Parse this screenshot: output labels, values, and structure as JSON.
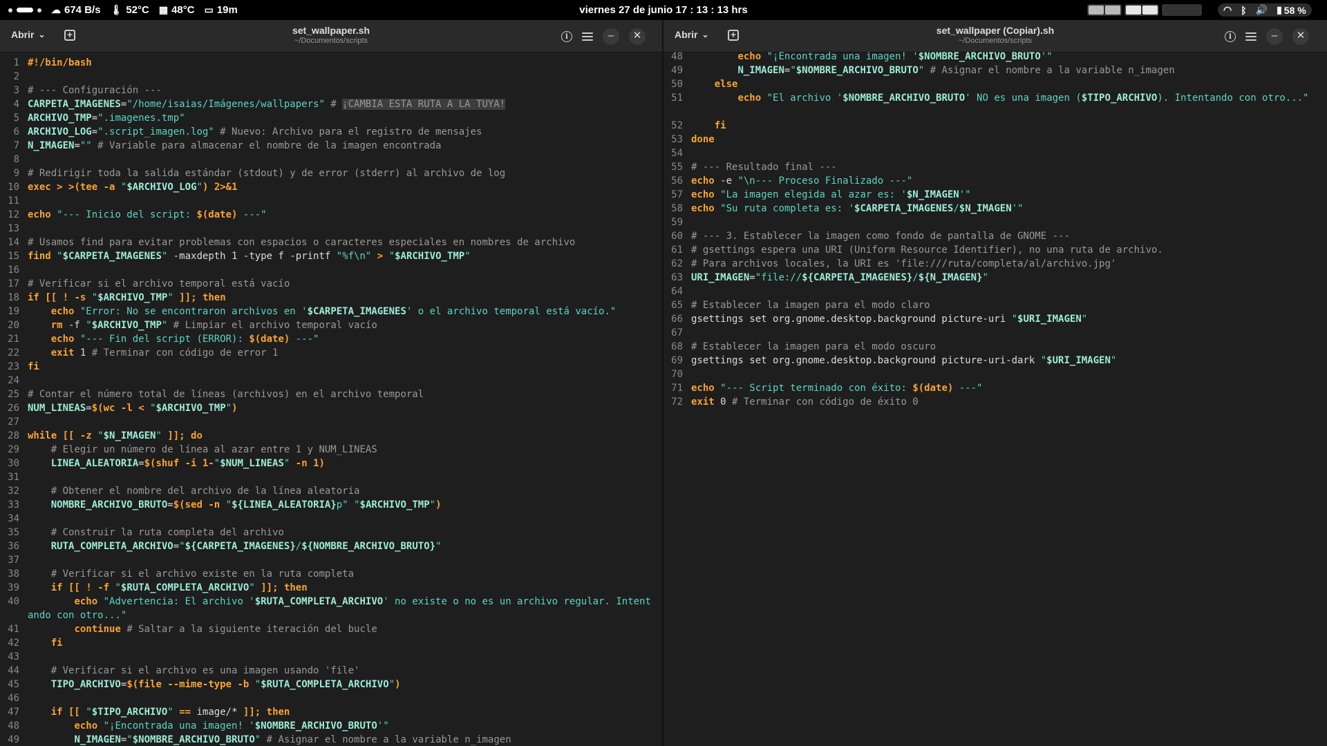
{
  "topbar": {
    "net_speed": "674 B/s",
    "cpu_temp": "52°C",
    "gpu_temp": "48°C",
    "uptime": "19m",
    "clock": "viernes 27 de junio  17 : 13 : 13 hrs",
    "battery": "58 %"
  },
  "left": {
    "open_label": "Abrir",
    "title": "set_wallpaper.sh",
    "path": "~/Documentos/scripts",
    "lines": [
      {
        "n": "1",
        "c": "<span class='k'>#!/bin/bash</span>"
      },
      {
        "n": "2",
        "c": ""
      },
      {
        "n": "3",
        "c": "<span class='c'># --- Configuración ---</span>"
      },
      {
        "n": "4",
        "c": "<span class='v'>CARPETA_IMAGENES</span>=<span class='s'>\"/home/isaias/Imágenes/wallpapers\"</span> <span class='c'># <span class='hl'>¡CAMBIA ESTA RUTA A LA TUYA!</span></span>"
      },
      {
        "n": "5",
        "c": "<span class='v'>ARCHIVO_TMP</span>=<span class='s'>\".imagenes.tmp\"</span>"
      },
      {
        "n": "6",
        "c": "<span class='v'>ARCHIVO_LOG</span>=<span class='s'>\".script_imagen.log\"</span> <span class='c'># Nuevo: Archivo para el registro de mensajes</span>"
      },
      {
        "n": "7",
        "c": "<span class='v'>N_IMAGEN</span>=<span class='s'>\"\"</span> <span class='c'># Variable para almacenar el nombre de la imagen encontrada</span>"
      },
      {
        "n": "8",
        "c": ""
      },
      {
        "n": "9",
        "c": "<span class='c'># Redirigir toda la salida estándar (stdout) y de error (stderr) al archivo de log</span>"
      },
      {
        "n": "10",
        "c": "<span class='k'>exec</span> <span class='k'>&gt;</span> <span class='k'>&gt;(tee</span> <span class='k'>-a</span> <span class='s'>\"</span><span class='v'>$ARCHIVO_LOG</span><span class='s'>\"</span><span class='k'>)</span> <span class='k'>2&gt;&amp;1</span>"
      },
      {
        "n": "11",
        "c": ""
      },
      {
        "n": "12",
        "c": "<span class='k'>echo</span> <span class='s'>\"--- Inicio del script: </span><span class='k'>$(date)</span><span class='s'> ---\"</span>"
      },
      {
        "n": "13",
        "c": ""
      },
      {
        "n": "14",
        "c": "<span class='c'># Usamos find para evitar problemas con espacios o caracteres especiales en nombres de archivo</span>"
      },
      {
        "n": "15",
        "c": "<span class='k'>find</span> <span class='s'>\"</span><span class='v'>$CARPETA_IMAGENES</span><span class='s'>\"</span> -maxdepth 1 -type f -printf <span class='s'>\"%f\\n\"</span> <span class='k'>&gt;</span> <span class='s'>\"</span><span class='v'>$ARCHIVO_TMP</span><span class='s'>\"</span>"
      },
      {
        "n": "16",
        "c": ""
      },
      {
        "n": "17",
        "c": "<span class='c'># Verificar si el archivo temporal está vacío</span>"
      },
      {
        "n": "18",
        "c": "<span class='k'>if [[</span> <span class='k'>!</span> <span class='k'>-s</span> <span class='s'>\"</span><span class='v'>$ARCHIVO_TMP</span><span class='s'>\"</span> <span class='k'>]]; then</span>"
      },
      {
        "n": "19",
        "c": "    <span class='k'>echo</span> <span class='s'>\"Error: No se encontraron archivos en '</span><span class='v'>$CARPETA_IMAGENES</span><span class='s'>' o el archivo temporal está vacío.\"</span>"
      },
      {
        "n": "20",
        "c": "    <span class='k'>rm</span> -f <span class='s'>\"</span><span class='v'>$ARCHIVO_TMP</span><span class='s'>\"</span> <span class='c'># Limpiar el archivo temporal vacío</span>"
      },
      {
        "n": "21",
        "c": "    <span class='k'>echo</span> <span class='s'>\"--- Fin del script (ERROR): </span><span class='k'>$(date)</span><span class='s'> ---\"</span>"
      },
      {
        "n": "22",
        "c": "    <span class='k'>exit</span> 1 <span class='c'># Terminar con código de error 1</span>"
      },
      {
        "n": "23",
        "c": "<span class='k'>fi</span>"
      },
      {
        "n": "24",
        "c": ""
      },
      {
        "n": "25",
        "c": "<span class='c'># Contar el número total de líneas (archivos) en el archivo temporal</span>"
      },
      {
        "n": "26",
        "c": "<span class='v'>NUM_LINEAS</span>=<span class='k'>$(wc</span> <span class='k'>-l</span> <span class='k'>&lt;</span> <span class='s'>\"</span><span class='v'>$ARCHIVO_TMP</span><span class='s'>\"</span><span class='k'>)</span>"
      },
      {
        "n": "27",
        "c": ""
      },
      {
        "n": "28",
        "c": "<span class='k'>while [[</span> <span class='k'>-z</span> <span class='s'>\"</span><span class='v'>$N_IMAGEN</span><span class='s'>\"</span> <span class='k'>]]; do</span>"
      },
      {
        "n": "29",
        "c": "    <span class='c'># Elegir un número de línea al azar entre 1 y NUM_LINEAS</span>"
      },
      {
        "n": "30",
        "c": "    <span class='v'>LINEA_ALEATORIA</span>=<span class='k'>$(</span><span class='k'>shuf -i 1-</span><span class='s'>\"</span><span class='v'>$NUM_LINEAS</span><span class='s'>\"</span> <span class='k'>-n 1</span><span class='k'>)</span>"
      },
      {
        "n": "31",
        "c": ""
      },
      {
        "n": "32",
        "c": "    <span class='c'># Obtener el nombre del archivo de la línea aleatoria</span>"
      },
      {
        "n": "33",
        "c": "    <span class='v'>NOMBRE_ARCHIVO_BRUTO</span>=<span class='k'>$(sed</span> <span class='k'>-n</span> <span class='s'>\"</span><span class='v'>${LINEA_ALEATORIA}</span><span class='s'>p\"</span> <span class='s'>\"</span><span class='v'>$ARCHIVO_TMP</span><span class='s'>\"</span><span class='k'>)</span>"
      },
      {
        "n": "34",
        "c": ""
      },
      {
        "n": "35",
        "c": "    <span class='c'># Construir la ruta completa del archivo</span>"
      },
      {
        "n": "36",
        "c": "    <span class='v'>RUTA_COMPLETA_ARCHIVO</span>=<span class='s'>\"</span><span class='v'>${CARPETA_IMAGENES}</span><span class='s'>/</span><span class='v'>${NOMBRE_ARCHIVO_BRUTO}</span><span class='s'>\"</span>"
      },
      {
        "n": "37",
        "c": ""
      },
      {
        "n": "38",
        "c": "    <span class='c'># Verificar si el archivo existe en la ruta completa</span>"
      },
      {
        "n": "39",
        "c": "    <span class='k'>if [[</span> <span class='k'>!</span> <span class='k'>-f</span> <span class='s'>\"</span><span class='v'>$RUTA_COMPLETA_ARCHIVO</span><span class='s'>\"</span> <span class='k'>]]; then</span>"
      },
      {
        "n": "40",
        "c": "        <span class='k'>echo</span> <span class='s'>\"Advertencia: El archivo '</span><span class='v'>$RUTA_COMPLETA_ARCHIVO</span><span class='s'>' no existe o no es un archivo regular. Intentando con otro...\"</span>",
        "tall": true
      },
      {
        "n": "41",
        "c": "        <span class='k'>continue</span> <span class='c'># Saltar a la siguiente iteración del bucle</span>"
      },
      {
        "n": "42",
        "c": "    <span class='k'>fi</span>"
      },
      {
        "n": "43",
        "c": ""
      },
      {
        "n": "44",
        "c": "    <span class='c'># Verificar si el archivo es una imagen usando 'file'</span>"
      },
      {
        "n": "45",
        "c": "    <span class='v'>TIPO_ARCHIVO</span>=<span class='k'>$(file</span> <span class='k'>--mime-type -b</span> <span class='s'>\"</span><span class='v'>$RUTA_COMPLETA_ARCHIVO</span><span class='s'>\"</span><span class='k'>)</span>"
      },
      {
        "n": "46",
        "c": ""
      },
      {
        "n": "47",
        "c": "    <span class='k'>if [[</span> <span class='s'>\"</span><span class='v'>$TIPO_ARCHIVO</span><span class='s'>\"</span> <span class='k'>==</span> image/* <span class='k'>]]; then</span>"
      },
      {
        "n": "48",
        "c": "        <span class='k'>echo</span> <span class='s'>\"¡Encontrada una imagen! '</span><span class='v'>$NOMBRE_ARCHIVO_BRUTO</span><span class='s'>'\"</span>"
      },
      {
        "n": "49",
        "c": "        <span class='v'>N_IMAGEN</span>=<span class='s'>\"</span><span class='v'>$NOMBRE_ARCHIVO_BRUTO</span><span class='s'>\"</span> <span class='c'># Asignar el nombre a la variable n_imagen</span>"
      }
    ]
  },
  "right": {
    "open_label": "Abrir",
    "title": "set_wallpaper (Copiar).sh",
    "path": "~/Documentos/scripts",
    "lines": [
      {
        "n": "48",
        "c": "        <span class='k'>echo</span> <span class='s'>\"¡Encontrada una imagen! '</span><span class='v'>$NOMBRE_ARCHIVO_BRUTO</span><span class='s'>'\"</span>"
      },
      {
        "n": "49",
        "c": "        <span class='v'>N_IMAGEN</span>=<span class='s'>\"</span><span class='v'>$NOMBRE_ARCHIVO_BRUTO</span><span class='s'>\"</span> <span class='c'># Asignar el nombre a la variable n_imagen</span>"
      },
      {
        "n": "50",
        "c": "    <span class='k'>else</span>"
      },
      {
        "n": "51",
        "c": "        <span class='k'>echo</span> <span class='s'>\"El archivo '</span><span class='v'>$NOMBRE_ARCHIVO_BRUTO</span><span class='s'>' NO es una imagen (</span><span class='v'>$TIPO_ARCHIVO</span><span class='s'>). Intentando con otro...\"</span>",
        "tall": true
      },
      {
        "n": "52",
        "c": "    <span class='k'>fi</span>"
      },
      {
        "n": "53",
        "c": "<span class='k'>done</span>"
      },
      {
        "n": "54",
        "c": ""
      },
      {
        "n": "55",
        "c": "<span class='c'># --- Resultado final ---</span>"
      },
      {
        "n": "56",
        "c": "<span class='k'>echo</span> -e <span class='s'>\"\\n--- Proceso Finalizado ---\"</span>"
      },
      {
        "n": "57",
        "c": "<span class='k'>echo</span> <span class='s'>\"La imagen elegida al azar es: '</span><span class='v'>$N_IMAGEN</span><span class='s'>'\"</span>"
      },
      {
        "n": "58",
        "c": "<span class='k'>echo</span> <span class='s'>\"Su ruta completa es: '</span><span class='v'>$CARPETA_IMAGENES</span><span class='s'>/</span><span class='v'>$N_IMAGEN</span><span class='s'>'\"</span>"
      },
      {
        "n": "59",
        "c": ""
      },
      {
        "n": "60",
        "c": "<span class='c'># --- 3. Establecer la imagen como fondo de pantalla de GNOME ---</span>"
      },
      {
        "n": "61",
        "c": "<span class='c'># gsettings espera una URI (Uniform Resource Identifier), no una ruta de archivo.</span>"
      },
      {
        "n": "62",
        "c": "<span class='c'># Para archivos locales, la URI es 'file:///ruta/completa/al/archivo.jpg'</span>"
      },
      {
        "n": "63",
        "c": "<span class='v'>URI_IMAGEN</span>=<span class='s'>\"file://</span><span class='v'>${CARPETA_IMAGENES}</span><span class='s'>/</span><span class='v'>${N_IMAGEN}</span><span class='s'>\"</span>"
      },
      {
        "n": "64",
        "c": ""
      },
      {
        "n": "65",
        "c": "<span class='c'># Establecer la imagen para el modo claro</span>"
      },
      {
        "n": "66",
        "c": "gsettings set org.gnome.desktop.background picture-uri <span class='s'>\"</span><span class='v'>$URI_IMAGEN</span><span class='s'>\"</span>"
      },
      {
        "n": "67",
        "c": ""
      },
      {
        "n": "68",
        "c": "<span class='c'># Establecer la imagen para el modo oscuro</span>"
      },
      {
        "n": "69",
        "c": "gsettings set org.gnome.desktop.background picture-uri-dark <span class='s'>\"</span><span class='v'>$URI_IMAGEN</span><span class='s'>\"</span>"
      },
      {
        "n": "70",
        "c": ""
      },
      {
        "n": "71",
        "c": "<span class='k'>echo</span> <span class='s'>\"--- Script terminado con éxito: </span><span class='k'>$(date)</span><span class='s'> ---\"</span>"
      },
      {
        "n": "72",
        "c": "<span class='k'>exit</span> 0 <span class='c'># Terminar con código de éxito 0</span>"
      }
    ]
  }
}
